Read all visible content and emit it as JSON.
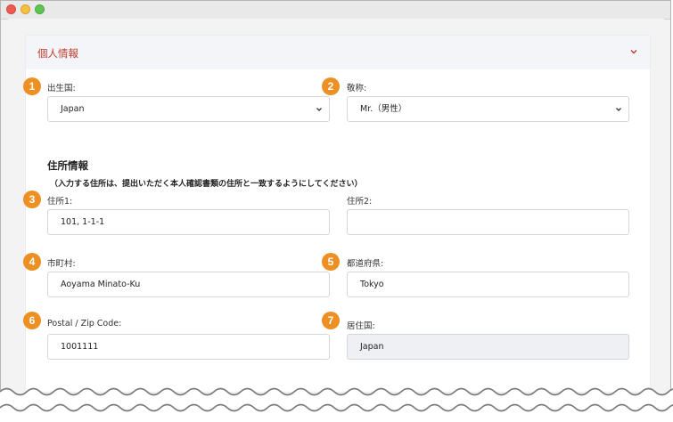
{
  "section": {
    "title": "個人情報",
    "chevron_icon": "chevron-down-icon"
  },
  "colors": {
    "accent_red": "#c0392b",
    "badge_orange": "#ee8f24"
  },
  "fields": {
    "birth_country": {
      "badge": "1",
      "label": "出生国:",
      "value": "Japan"
    },
    "title": {
      "badge": "2",
      "label": "敬称:",
      "value": "Mr.（男性）"
    },
    "address_section": {
      "heading": "住所情報",
      "note": "（入力する住所は、提出いただく本人確認書類の住所と一致するようにしてください）"
    },
    "address1": {
      "badge": "3",
      "label": "住所1:",
      "value": "101, 1-1-1"
    },
    "address2": {
      "label": "住所2:",
      "value": ""
    },
    "city": {
      "badge": "4",
      "label": "市町村:",
      "value": "Aoyama  Minato-Ku"
    },
    "prefecture": {
      "badge": "5",
      "label": "都道府県:",
      "value": "Tokyo"
    },
    "postal": {
      "badge": "6",
      "label": "Postal / Zip Code:",
      "value": "1001111"
    },
    "residence_country": {
      "badge": "7",
      "label": "居住国:",
      "value": "Japan"
    }
  }
}
